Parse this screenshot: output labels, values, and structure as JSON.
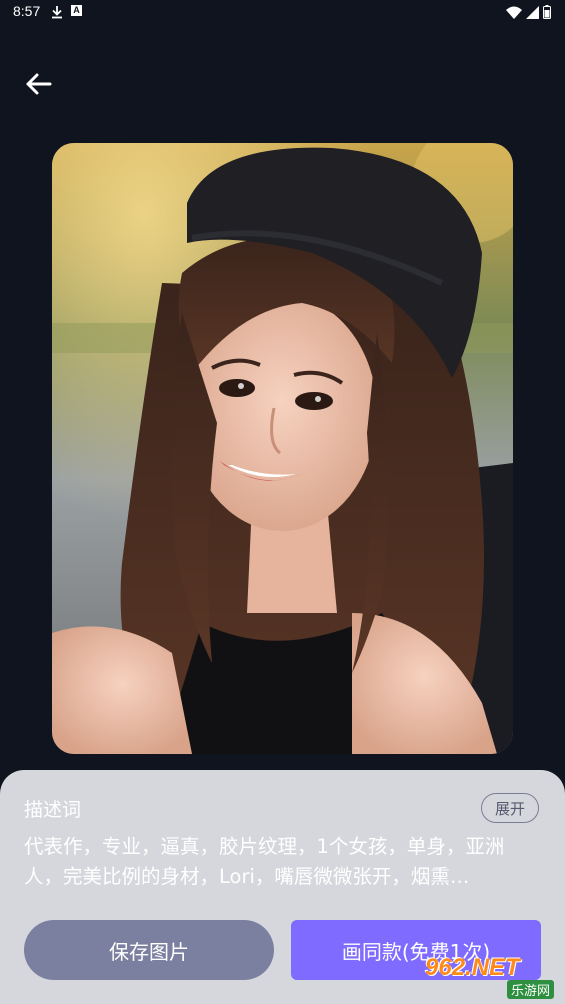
{
  "status_bar": {
    "time": "8:57",
    "icons": [
      "download-icon",
      "a-badge-icon",
      "wifi-icon",
      "signal-icon",
      "battery-icon"
    ],
    "a_badge": "A"
  },
  "header": {
    "back_icon": "arrow-left-icon"
  },
  "image": {
    "subject": "portrait"
  },
  "description": {
    "title": "描述词",
    "expand_label": "展开",
    "text": "代表作，专业，逼真，胶片纹理，1个女孩，单身，亚洲人，完美比例的身材，Lori，嘴唇微微张开，烟熏…"
  },
  "actions": {
    "save_label": "保存图片",
    "draw_label": "画同款(免费1次)"
  },
  "watermark": {
    "main": "962.NET",
    "sub": "乐游网"
  },
  "colors": {
    "background": "#10141f",
    "sheet": "#d6d7dc",
    "save_button": "#7b80a0",
    "draw_button": "#7f6bff"
  }
}
